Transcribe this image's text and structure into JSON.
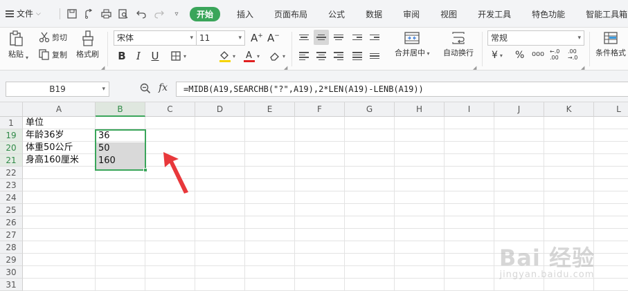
{
  "menu": {
    "file_label": "文件",
    "tabs": [
      {
        "label": "开始",
        "active": true
      },
      {
        "label": "插入"
      },
      {
        "label": "页面布局"
      },
      {
        "label": "公式"
      },
      {
        "label": "数据"
      },
      {
        "label": "审阅"
      },
      {
        "label": "视图"
      },
      {
        "label": "开发工具"
      },
      {
        "label": "特色功能"
      },
      {
        "label": "智能工具箱"
      }
    ]
  },
  "ribbon": {
    "paste": "粘贴",
    "cut": "剪切",
    "copy": "复制",
    "format_painter": "格式刷",
    "font_name": "宋体",
    "font_size": "11",
    "number_format": "常规",
    "merge_center": "合并居中",
    "wrap_text": "自动换行",
    "conditional_format": "条件格式",
    "bold": "B",
    "italic": "I",
    "underline": "U"
  },
  "formula_bar": {
    "name_box": "B19",
    "fx": "fx",
    "formula": "=MIDB(A19,SEARCHB(\"?\",A19),2*LEN(A19)-LENB(A19))"
  },
  "sheet": {
    "columns": [
      "A",
      "B",
      "C",
      "D",
      "E",
      "F",
      "G",
      "H",
      "I",
      "J",
      "K",
      "L"
    ],
    "selected_column": "B",
    "rows": [
      "1",
      "19",
      "20",
      "21",
      "22",
      "23",
      "24",
      "25",
      "26",
      "27",
      "28",
      "29",
      "30",
      "31"
    ],
    "cells": {
      "A1": "单位",
      "A19": "年龄36岁",
      "B19": "36",
      "A20": "体重50公斤",
      "B20": "50",
      "A21": "身高160厘米",
      "B21": "160"
    },
    "accent_color": "#3aa55a",
    "arrow_color": "#e8383b"
  },
  "watermark": {
    "brand": "Bai 经验",
    "url": "jingyan.baidu.com"
  }
}
